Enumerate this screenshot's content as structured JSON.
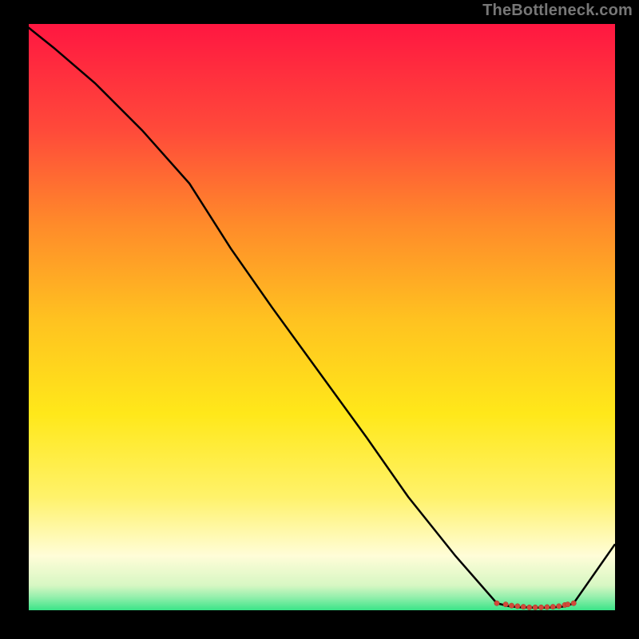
{
  "watermark": "TheBottleneck.com",
  "chart_data": {
    "type": "line",
    "title": "",
    "xlabel": "",
    "ylabel": "",
    "xlim": [
      0,
      100
    ],
    "ylim": [
      0,
      100
    ],
    "grid": false,
    "legend": false,
    "background_gradient": {
      "top_color": "#ff1741",
      "mid_colors": [
        "#ff6a2e",
        "#ffc220",
        "#ffe81a",
        "#fff9b0"
      ],
      "bottom_color": "#19e07a"
    },
    "series": [
      {
        "name": "bottleneck-curve",
        "x": [
          0,
          5,
          12,
          20,
          28,
          35,
          42,
          50,
          58,
          65,
          73,
          80,
          82,
          84,
          85,
          86.5,
          88,
          89.5,
          91,
          92,
          93,
          100
        ],
        "y": [
          100,
          96,
          90,
          82,
          73,
          62,
          52,
          41,
          30,
          20,
          10,
          2,
          1.5,
          1.3,
          1.3,
          1.25,
          1.25,
          1.3,
          1.4,
          1.6,
          2,
          12
        ]
      }
    ],
    "markers": {
      "name": "dense-cluster",
      "color": "#d04a3a",
      "x": [
        80,
        81.5,
        82.5,
        83.5,
        84.5,
        85.5,
        86.5,
        87.5,
        88.5,
        89.5,
        90.5,
        91.5,
        92,
        93
      ],
      "y": [
        2.0,
        1.8,
        1.6,
        1.5,
        1.4,
        1.3,
        1.3,
        1.3,
        1.35,
        1.4,
        1.5,
        1.7,
        1.8,
        2.0
      ]
    },
    "notes": "Curve descending from top-left to near zero around x=80-93, then rising toward the right edge. Dense small red markers sit on the trough region. Background is a vertical gradient red→orange→yellow→pale→green."
  }
}
